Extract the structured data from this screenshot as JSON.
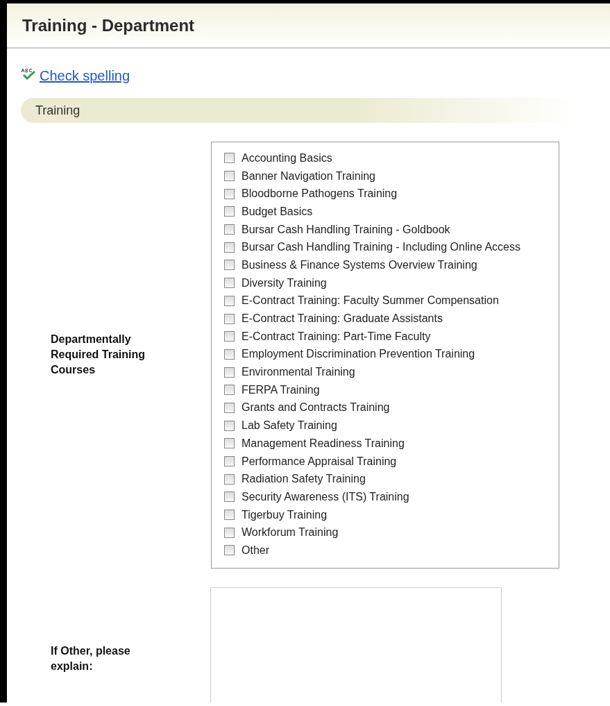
{
  "page": {
    "title": "Training - Department"
  },
  "spellcheck": {
    "label": "Check spelling"
  },
  "section": {
    "title": "Training"
  },
  "courses_field": {
    "label": "Departmentally Required Training Courses",
    "options": [
      {
        "label": "Accounting Basics",
        "checked": false
      },
      {
        "label": "Banner Navigation Training",
        "checked": false
      },
      {
        "label": "Bloodborne Pathogens Training",
        "checked": false
      },
      {
        "label": "Budget Basics",
        "checked": false
      },
      {
        "label": "Bursar Cash Handling Training - Goldbook",
        "checked": false
      },
      {
        "label": "Bursar Cash Handling Training - Including Online Access",
        "checked": false
      },
      {
        "label": "Business & Finance Systems Overview Training",
        "checked": false
      },
      {
        "label": "Diversity Training",
        "checked": false
      },
      {
        "label": "E-Contract Training: Faculty Summer Compensation",
        "checked": false
      },
      {
        "label": "E-Contract Training: Graduate Assistants",
        "checked": false
      },
      {
        "label": "E-Contract Training: Part-Time Faculty",
        "checked": false
      },
      {
        "label": "Employment Discrimination Prevention Training",
        "checked": false
      },
      {
        "label": "Environmental Training",
        "checked": false
      },
      {
        "label": "FERPA Training",
        "checked": false
      },
      {
        "label": "Grants and Contracts Training",
        "checked": false
      },
      {
        "label": "Lab Safety Training",
        "checked": false
      },
      {
        "label": "Management Readiness Training",
        "checked": false
      },
      {
        "label": "Performance Appraisal Training",
        "checked": false
      },
      {
        "label": "Radiation Safety Training",
        "checked": false
      },
      {
        "label": "Security Awareness (ITS) Training",
        "checked": false
      },
      {
        "label": "Tigerbuy Training",
        "checked": false
      },
      {
        "label": "Workforum Training",
        "checked": false
      },
      {
        "label": "Other",
        "checked": false
      }
    ]
  },
  "other_field": {
    "label": "If Other, please explain:"
  }
}
